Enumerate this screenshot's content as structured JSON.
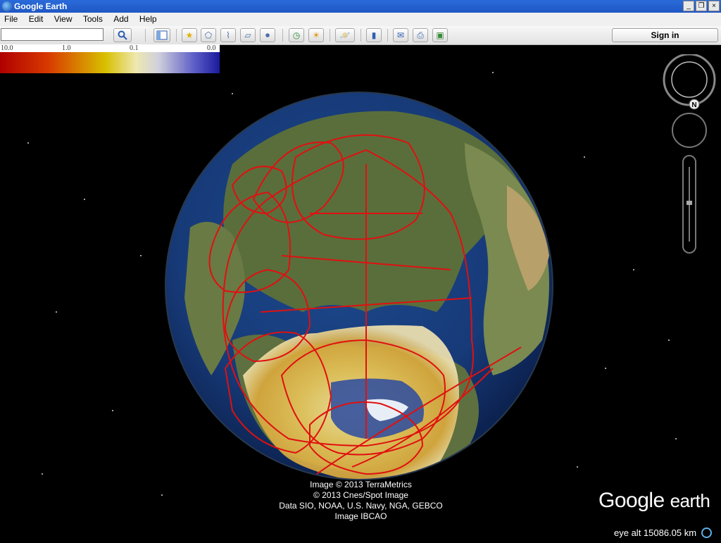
{
  "window": {
    "title": "Google Earth",
    "controls": [
      "_",
      "❐",
      "×"
    ]
  },
  "menu": [
    "File",
    "Edit",
    "View",
    "Tools",
    "Add",
    "Help"
  ],
  "search": {
    "value": "",
    "button_icon": "magnifier-icon"
  },
  "toolbar": {
    "buttons": [
      "sidebar-toggle",
      "add-placemark",
      "add-polygon",
      "add-path",
      "add-image-overlay",
      "record-tour",
      "historical-imagery",
      "sunlight",
      "switch-to-sky",
      "ruler",
      "email",
      "print",
      "save-image"
    ],
    "sign_in_label": "Sign in"
  },
  "legend": {
    "ticks": [
      "10.0",
      "1.0",
      "0.1",
      "0.0"
    ],
    "colors": [
      "#b00000",
      "#d83a00",
      "#d8c000",
      "#eee8b0",
      "#d0d0dc",
      "#6060c8",
      "#1a1a9e"
    ]
  },
  "navigation": {
    "compass_north_label": "N"
  },
  "credits": [
    "Image © 2013 TerraMetrics",
    "© 2013 Cnes/Spot Image",
    "Data SIO, NOAA, U.S. Navy, NGA, GEBCO",
    "Image IBCAO"
  ],
  "logo": {
    "google": "Google",
    "earth": "earth"
  },
  "status": {
    "eye_alt": "eye alt 15086.05 km"
  }
}
